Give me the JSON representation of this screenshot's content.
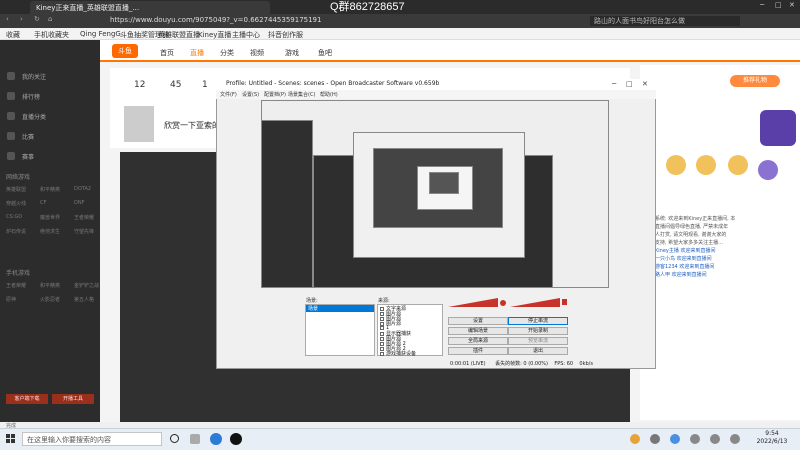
{
  "browser": {
    "tab_title": "Kiney正来直播_英雄联盟直播_...",
    "qq_watermark": "Q群862728657",
    "url": "https://www.douyu.com/9075049?_v=0.6627445359175191",
    "search_placeholder": "路山的人面书鸟好阳台怎么做",
    "bookmarks": [
      "收藏",
      "手机收藏夹",
      "Qing FengG",
      "斗鱼抽奖管理器",
      "英雄联盟直播",
      "Kiney直播",
      "主播中心",
      "抖音创作服"
    ]
  },
  "sidebar": {
    "items": [
      "我的关注",
      "排行榜",
      "直播分类",
      "比赛",
      "赛事"
    ],
    "section1": "网络游戏",
    "grid1": [
      "英雄联盟",
      "和平精英",
      "DOTA2",
      "穿越火线",
      "CF",
      "DNF",
      "CS:GO",
      "魔兽世界",
      "王者荣耀",
      "炉石传说",
      "绝地求生",
      "守望先锋"
    ],
    "section2": "手机游戏",
    "grid2": [
      "王者荣耀",
      "和平精英",
      "金铲铲之战",
      "原神",
      "火影忍者",
      "第五人格"
    ],
    "btn1": "客户端下载",
    "btn2": "开播工具"
  },
  "page": {
    "logo": "斗鱼",
    "nav": [
      "首页",
      "直播",
      "分类",
      "视频",
      "游戏",
      "鱼吧"
    ],
    "stat1": "12",
    "stat2": "45",
    "stat3": "1",
    "live_title": "欣赏一下亚索的...",
    "rec_badge": "推荐礼物"
  },
  "chat": [
    "系统: 欢迎来到Kiney正来直播间, 本",
    "直播间倡导绿色直播, 严禁未成年",
    "人打赏, 请文明观看, 谢谢大家的",
    "支持, 希望大家多多关注主播...",
    "",
    "Kiney主播 欢迎来到直播间",
    "一只小鸟 欢迎来到直播间",
    "游客1234 欢迎来到直播间",
    "路人甲 欢迎来到直播间"
  ],
  "obs": {
    "title": "Profile: Untitled - Scenes: scenes - Open Broadcaster Software v0.659b",
    "menu": [
      "文件(F)",
      "设置(S)",
      "配置档(P)",
      "场景集合(C)",
      "帮助(H)"
    ],
    "scenes_label": "场景:",
    "sources_label": "来源:",
    "scene_items": [
      "场景"
    ],
    "sources": [
      "文字来源",
      "图片源",
      "图片源",
      "图片源",
      "1",
      "显示器捕获",
      "图片源",
      "图片源 2",
      "图片源 2",
      "游戏捕获设备"
    ],
    "buttons": {
      "settings": "设置",
      "stop_stream": "停止串流",
      "edit_scene": "编辑场景",
      "start_record": "开始录制",
      "global_sources": "全局来源",
      "preview": "预览串流",
      "plugins": "插件",
      "exit": "退出"
    },
    "status": {
      "time": "0:00:01 (LIVE)",
      "dropped": "丢失的帧数: 0 (0.00%)",
      "fps": "FPS: 60",
      "kbps": "0kb/s"
    }
  },
  "statusbar": "完成",
  "taskbar": {
    "search": "在这里输入你要搜索的内容",
    "time": "9:54",
    "date": "2022/6/13"
  },
  "colors": {
    "accent": "#ff7700",
    "sidebar_bg": "#2c2c2c",
    "obs_highlight": "#0078d7"
  }
}
